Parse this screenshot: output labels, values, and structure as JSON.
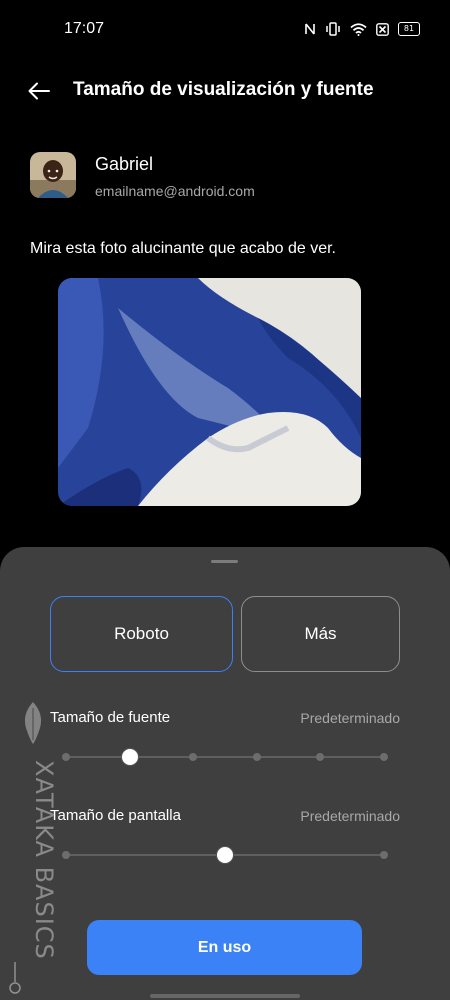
{
  "status_bar": {
    "time": "17:07",
    "battery": "81",
    "icons": [
      "nfc-icon",
      "vibrate-icon",
      "wifi-icon",
      "sim-off-icon",
      "battery-icon"
    ]
  },
  "app_bar": {
    "title": "Tamaño de visualización y fuente",
    "back_icon": "arrow-left-icon"
  },
  "preview": {
    "sender_name": "Gabriel",
    "sender_email": "emailname@android.com",
    "message": "Mira esta foto alucinante que acabo de ver."
  },
  "font_options": {
    "selected": "Roboto",
    "roboto_label": "Roboto",
    "more_label": "Más"
  },
  "font_size": {
    "label": "Tamaño de fuente",
    "value": "Predeterminado",
    "steps": 6,
    "selected_index": 1
  },
  "display_size": {
    "label": "Tamaño de pantalla",
    "value": "Predeterminado",
    "steps": 3,
    "selected_index": 1
  },
  "apply_button": "En uso",
  "watermark": "XATAKA BASICS",
  "colors": {
    "accent": "#3b82f6",
    "background": "#000000",
    "sheet": "#3f3f3f",
    "secondary_text": "#a8a8a8"
  }
}
